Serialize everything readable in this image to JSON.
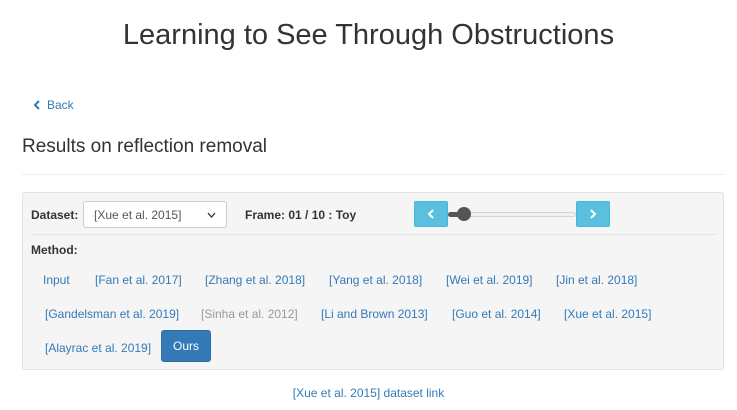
{
  "page": {
    "title": "Learning to See Through Obstructions",
    "back_label": "Back",
    "section_title": "Results on reflection removal"
  },
  "controls": {
    "dataset_label": "Dataset:",
    "dataset_selected": "[Xue et al. 2015]",
    "frame_label": "Frame: 01 / 10  : Toy",
    "slider_value": 0.1,
    "method_label": "Method:"
  },
  "methods": [
    {
      "label": "Input",
      "state": "link"
    },
    {
      "label": "[Fan et al. 2017]",
      "state": "link"
    },
    {
      "label": "[Zhang et al. 2018]",
      "state": "link"
    },
    {
      "label": "[Yang et al. 2018]",
      "state": "link"
    },
    {
      "label": "[Wei et al. 2019]",
      "state": "link"
    },
    {
      "label": "[Jin et al. 2018]",
      "state": "link"
    },
    {
      "label": "[Gandelsman et al. 2019]",
      "state": "link"
    },
    {
      "label": "[Sinha et al. 2012]",
      "state": "disabled"
    },
    {
      "label": "[Li and Brown 2013]",
      "state": "link"
    },
    {
      "label": "[Guo et al. 2014]",
      "state": "link"
    },
    {
      "label": "[Xue et al. 2015]",
      "state": "link"
    },
    {
      "label": "[Alayrac et al. 2019]",
      "state": "link"
    },
    {
      "label": "Ours",
      "state": "active"
    }
  ],
  "footer": {
    "dataset_link": "[Xue et al. 2015] dataset link"
  },
  "colors": {
    "link": "#337ab7",
    "primary": "#337ab7",
    "info": "#5bc0de",
    "muted": "#999999"
  }
}
